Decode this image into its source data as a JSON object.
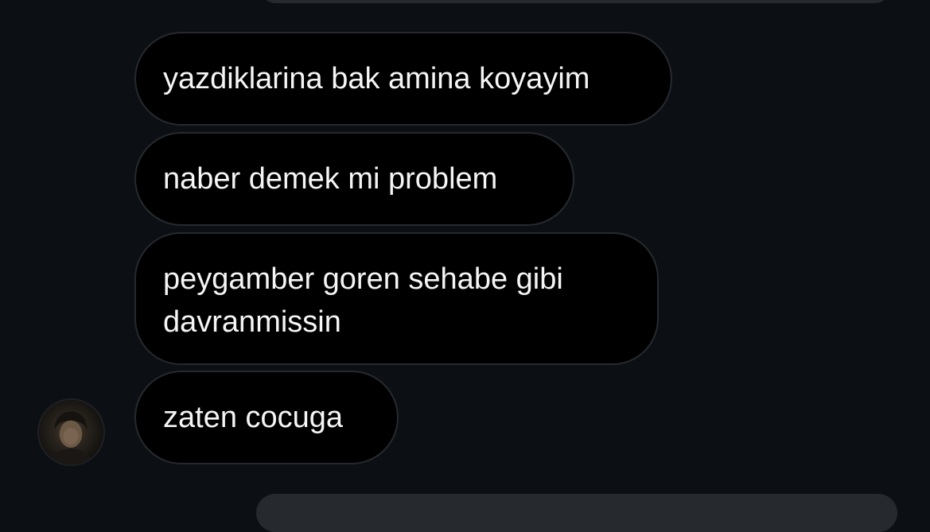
{
  "messages": [
    {
      "text": "yazdiklarina bak amina koyayim"
    },
    {
      "text": "naber demek mi problem"
    },
    {
      "lines": [
        "peygamber goren sehabe gibi",
        "davranmissin"
      ]
    },
    {
      "text": "zaten cocuga"
    }
  ],
  "avatar": {
    "icon": "user-avatar-photo"
  },
  "colors": {
    "background": "#0c1014",
    "bubble": "#000000",
    "bubble_border": "#262a2f",
    "text": "#f5f5f5"
  }
}
